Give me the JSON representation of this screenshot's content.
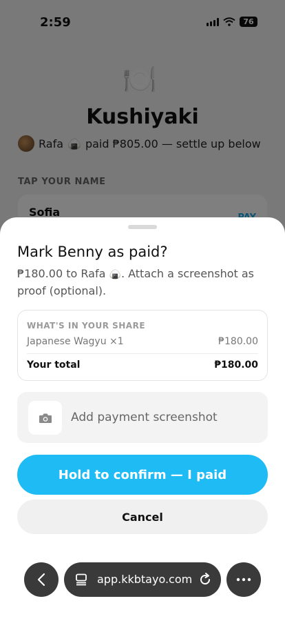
{
  "status_bar": {
    "time": "2:59",
    "battery": "76"
  },
  "page": {
    "restaurant": "Kushiyaki",
    "paid_by_name": "Rafa",
    "paid_text": "paid ₱805.00 — settle up below",
    "section_label": "TAP YOUR NAME",
    "first_name": "Sofia",
    "pay_tag": "PAY"
  },
  "sheet": {
    "title": "Mark Benny as paid?",
    "desc_before": "₱180.00 to Rafa",
    "desc_after": ". Attach a screenshot as proof (optional).",
    "share_label": "WHAT'S IN YOUR SHARE",
    "items": [
      {
        "name": "Japanese Wagyu ×1",
        "amount": "₱180.00"
      }
    ],
    "total_label": "Your total",
    "total_amount": "₱180.00",
    "upload_label": "Add payment screenshot",
    "confirm_label": "Hold to confirm — I paid",
    "cancel_label": "Cancel"
  },
  "browser": {
    "url": "app.kkbtayo.com"
  },
  "colors": {
    "accent": "#1ebbf5",
    "dim_overlay": "rgba(0,0,0,0.5)"
  }
}
